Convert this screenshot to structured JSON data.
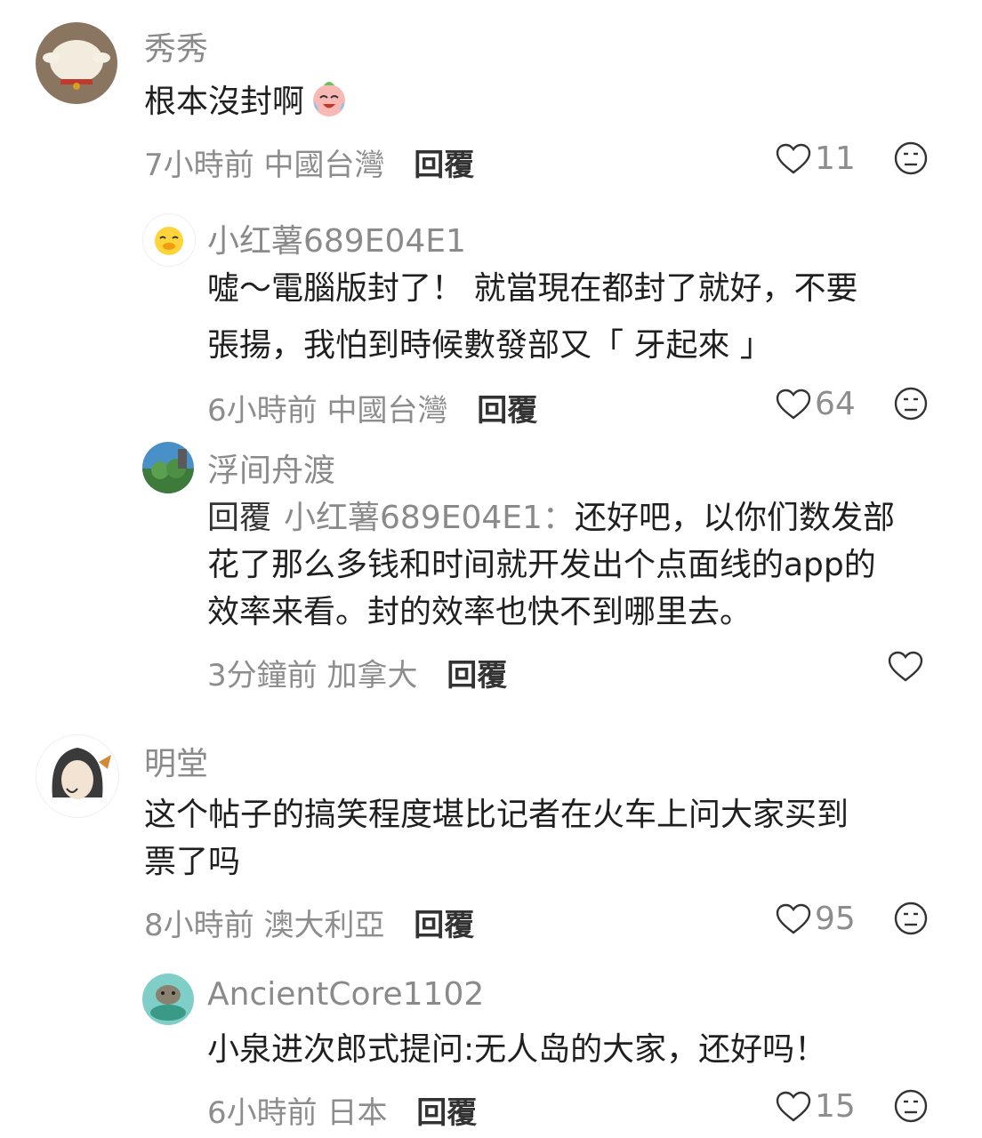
{
  "comments": [
    {
      "username": "秀秀",
      "text": "根本沒封啊",
      "emoji": "crying-laughing-emoji",
      "time": "7小時前",
      "location": "中國台灣",
      "reply_label": "回覆",
      "likes": "11",
      "replies": [
        {
          "username": "小红薯689E04E1",
          "text_lines": [
            "噓～電腦版封了！ 就當現在都封了就好，不要",
            "張揚，我怕到時候數發部又「 牙起來 」"
          ],
          "time": "6小時前",
          "location": "中國台灣",
          "reply_label": "回覆",
          "likes": "64"
        },
        {
          "username": "浮间舟渡",
          "reply_prefix": "回覆",
          "reply_target": "小红薯689E04E1：",
          "text_lines": [
            "还好吧，以你们数发部",
            "花了那么多钱和时间就开发出个点面线的app的",
            "效率来看。封的效率也快不到哪里去。"
          ],
          "time": "3分鐘前",
          "location": "加拿大",
          "reply_label": "回覆"
        }
      ]
    },
    {
      "username": "明堂",
      "text_lines": [
        "这个帖子的搞笑程度堪比记者在火车上问大家买到",
        "票了吗"
      ],
      "time": "8小時前",
      "location": "澳大利亞",
      "reply_label": "回覆",
      "likes": "95",
      "replies": [
        {
          "username": "AncientCore1102",
          "text": "小泉进次郎式提问:无人岛的大家，还好吗！",
          "time": "6小時前",
          "location": "日本",
          "reply_label": "回覆",
          "likes": "15"
        }
      ]
    }
  ]
}
